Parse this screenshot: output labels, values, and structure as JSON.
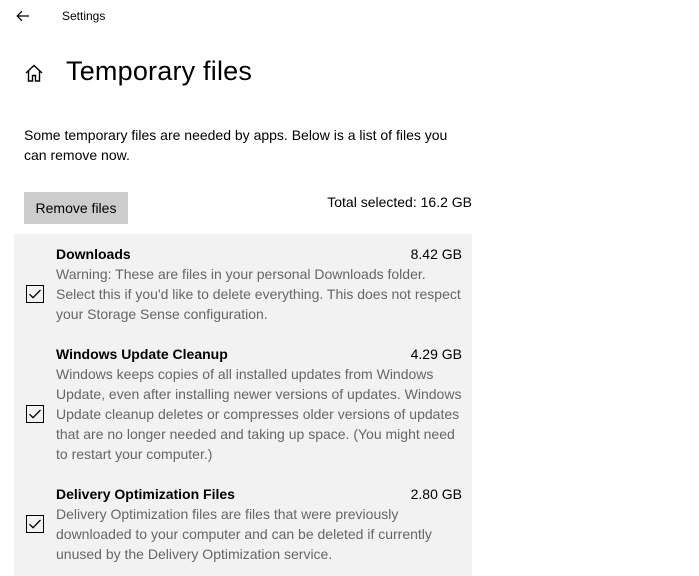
{
  "titlebar": {
    "back_icon": "back-arrow-icon",
    "app_title": "Settings"
  },
  "header": {
    "home_icon": "home-icon",
    "page_title": "Temporary files"
  },
  "description": "Some temporary files are needed by apps. Below is a list of files you can remove now.",
  "actions": {
    "remove_label": "Remove files",
    "total_selected": "Total selected: 16.2 GB"
  },
  "colors": {
    "panel_bg": "#f2f2f2",
    "button_bg": "#cccccc",
    "secondary_text": "#666666"
  },
  "items": [
    {
      "name": "Downloads",
      "size": "8.42 GB",
      "checked": true,
      "description": "Warning: These are files in your personal Downloads folder. Select this if you'd like to delete everything. This does not respect your Storage Sense configuration."
    },
    {
      "name": "Windows Update Cleanup",
      "size": "4.29 GB",
      "checked": true,
      "description": "Windows keeps copies of all installed updates from Windows Update, even after installing newer versions of updates. Windows Update cleanup deletes or compresses older versions of updates that are no longer needed and taking up space. (You might need to restart your computer.)"
    },
    {
      "name": "Delivery Optimization Files",
      "size": "2.80 GB",
      "checked": true,
      "description": "Delivery Optimization files are files that were previously downloaded to your computer and can be deleted if currently unused by the Delivery Optimization service."
    }
  ]
}
